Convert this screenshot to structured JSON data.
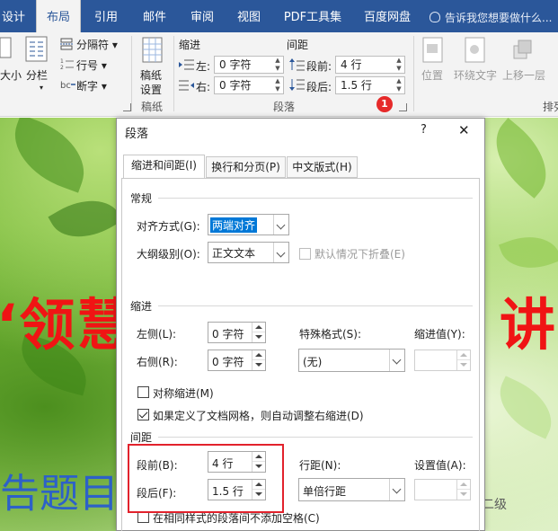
{
  "ribbon": {
    "tabs": [
      {
        "label": "设计",
        "active": false
      },
      {
        "label": "布局",
        "active": true
      },
      {
        "label": "引用",
        "active": false
      },
      {
        "label": "邮件",
        "active": false
      },
      {
        "label": "审阅",
        "active": false
      },
      {
        "label": "视图",
        "active": false
      },
      {
        "label": "PDF工具集",
        "active": false
      },
      {
        "label": "百度网盘",
        "active": false
      }
    ],
    "tell_me": "告诉我您想要做什么...",
    "size_label": "大小",
    "columns_label": "分栏",
    "breaks_label": "分隔符",
    "line_numbers_label": "行号",
    "hyphenation_label": "断字",
    "draft_paper_label_1": "稿纸",
    "draft_paper_label_2": "设置",
    "draft_group_label": "稿纸",
    "indent_group_title": "缩进",
    "indent_left_label": "左:",
    "indent_left_value": "0 字符",
    "indent_right_label": "右:",
    "indent_right_value": "0 字符",
    "spacing_group_title": "间距",
    "space_before_label": "段前:",
    "space_before_value": "4 行",
    "space_after_label": "段后:",
    "space_after_value": "1.5 行",
    "paragraph_group_label": "段落",
    "position_label": "位置",
    "wrap_text_label": "环绕文字",
    "bring_forward_label": "上移一层",
    "arrange_label": "排列",
    "step_badge": "1"
  },
  "document": {
    "red_text_left": "‘领慧",
    "red_text_right": "讲",
    "blue_text": "告题目",
    "watermark": "无忧考吧计算机二级"
  },
  "dialog": {
    "title": "段落",
    "help": "?",
    "close": "✕",
    "tabs": [
      "缩进和间距(I)",
      "换行和分页(P)",
      "中文版式(H)"
    ],
    "general_title": "常规",
    "alignment_label": "对齐方式(G):",
    "alignment_value": "两端对齐",
    "outline_label": "大纲级别(O):",
    "outline_value": "正文文本",
    "collapsed_label": "默认情况下折叠(E)",
    "indent_title": "缩进",
    "left_label": "左侧(L):",
    "left_value": "0 字符",
    "right_label": "右侧(R):",
    "right_value": "0 字符",
    "special_label": "特殊格式(S):",
    "special_value": "(无)",
    "indent_by_label": "缩进值(Y):",
    "indent_by_value": "",
    "mirror_label": "对称缩进(M)",
    "mirror_checked": false,
    "grid_label": "如果定义了文档网格，则自动调整右缩进(D)",
    "grid_checked": true,
    "spacing_title": "间距",
    "before_label": "段前(B):",
    "before_value": "4 行",
    "after_label": "段后(F):",
    "after_value": "1.5 行",
    "line_spacing_label": "行距(N):",
    "line_spacing_value": "单倍行距",
    "at_label": "设置值(A):",
    "at_value": "",
    "no_space_label": "在相同样式的段落间不添加空格(C)",
    "no_space_checked": false
  },
  "colors": {
    "ribbon_blue": "#2b579a",
    "highlight_red": "#e2222c",
    "doc_red_text": "#f01414",
    "doc_blue_text": "#2d61c8"
  }
}
